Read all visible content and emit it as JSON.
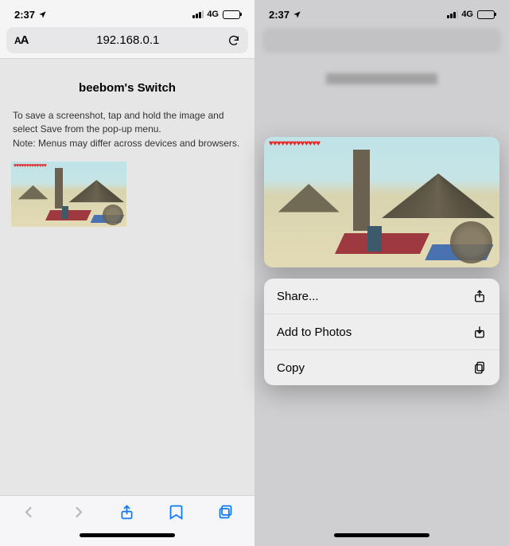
{
  "status": {
    "time": "2:37",
    "signal_label": "4G"
  },
  "browser": {
    "url": "192.168.0.1",
    "aa": "A"
  },
  "page": {
    "title": "beebom's Switch",
    "instructions": "To save a screenshot, tap and hold the image and select Save from the pop-up menu.\nNote: Menus may differ across devices and browsers."
  },
  "menu": {
    "share": "Share...",
    "add_photos": "Add to Photos",
    "copy": "Copy"
  }
}
